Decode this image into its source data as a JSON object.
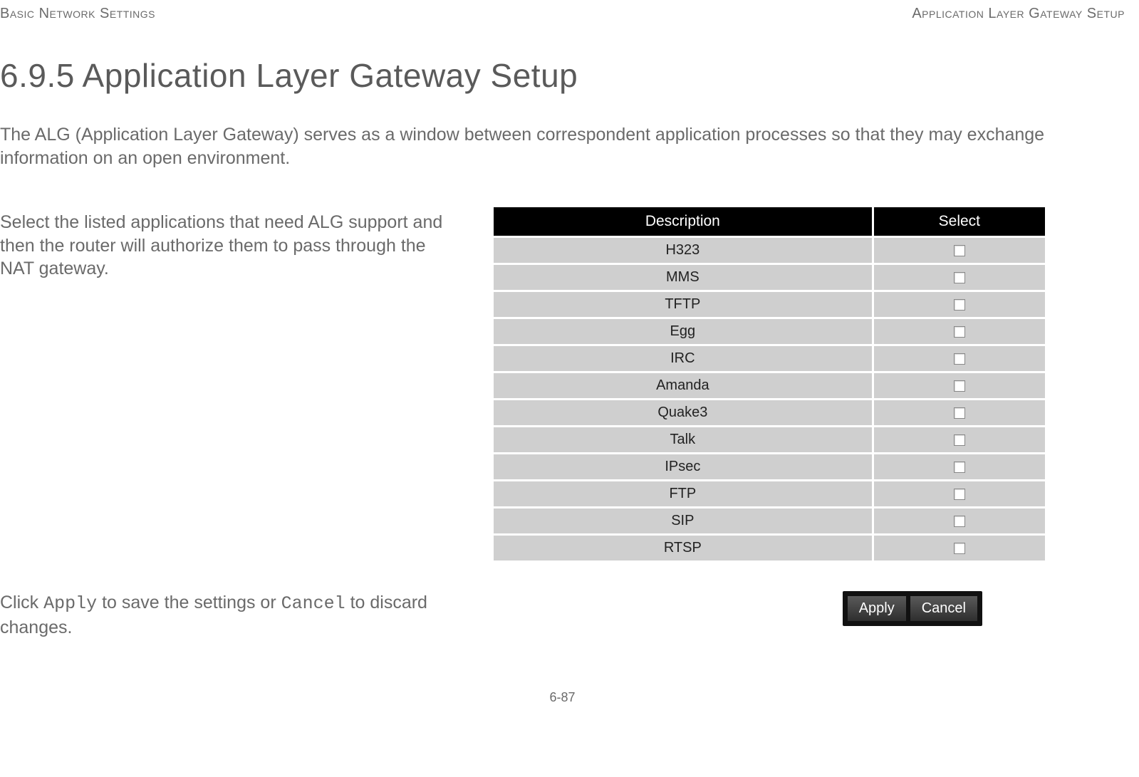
{
  "header": {
    "left": "Basic Network Settings",
    "right": "Application Layer Gateway Setup"
  },
  "page": {
    "title": "6.9.5 Application Layer Gateway Setup",
    "intro": "The ALG (Application Layer Gateway) serves as a window between correspondent application processes so that they may exchange information on an open environment.",
    "left_text": "Select the listed applications that need ALG support and then the router will authorize them to pass through the NAT gateway."
  },
  "table": {
    "headers": {
      "description": "Description",
      "select": "Select"
    },
    "rows": [
      {
        "desc": "H323",
        "checked": false
      },
      {
        "desc": "MMS",
        "checked": false
      },
      {
        "desc": "TFTP",
        "checked": false
      },
      {
        "desc": "Egg",
        "checked": false
      },
      {
        "desc": "IRC",
        "checked": false
      },
      {
        "desc": "Amanda",
        "checked": false
      },
      {
        "desc": "Quake3",
        "checked": false
      },
      {
        "desc": "Talk",
        "checked": false
      },
      {
        "desc": "IPsec",
        "checked": false
      },
      {
        "desc": "FTP",
        "checked": false
      },
      {
        "desc": "SIP",
        "checked": false
      },
      {
        "desc": "RTSP",
        "checked": false
      }
    ]
  },
  "footer": {
    "text_pre": "Click ",
    "apply_code": "Apply",
    "text_mid": " to save the settings or ",
    "cancel_code": "Cancel",
    "text_post": " to discard changes."
  },
  "buttons": {
    "apply": "Apply",
    "cancel": "Cancel"
  },
  "page_number": "6-87"
}
